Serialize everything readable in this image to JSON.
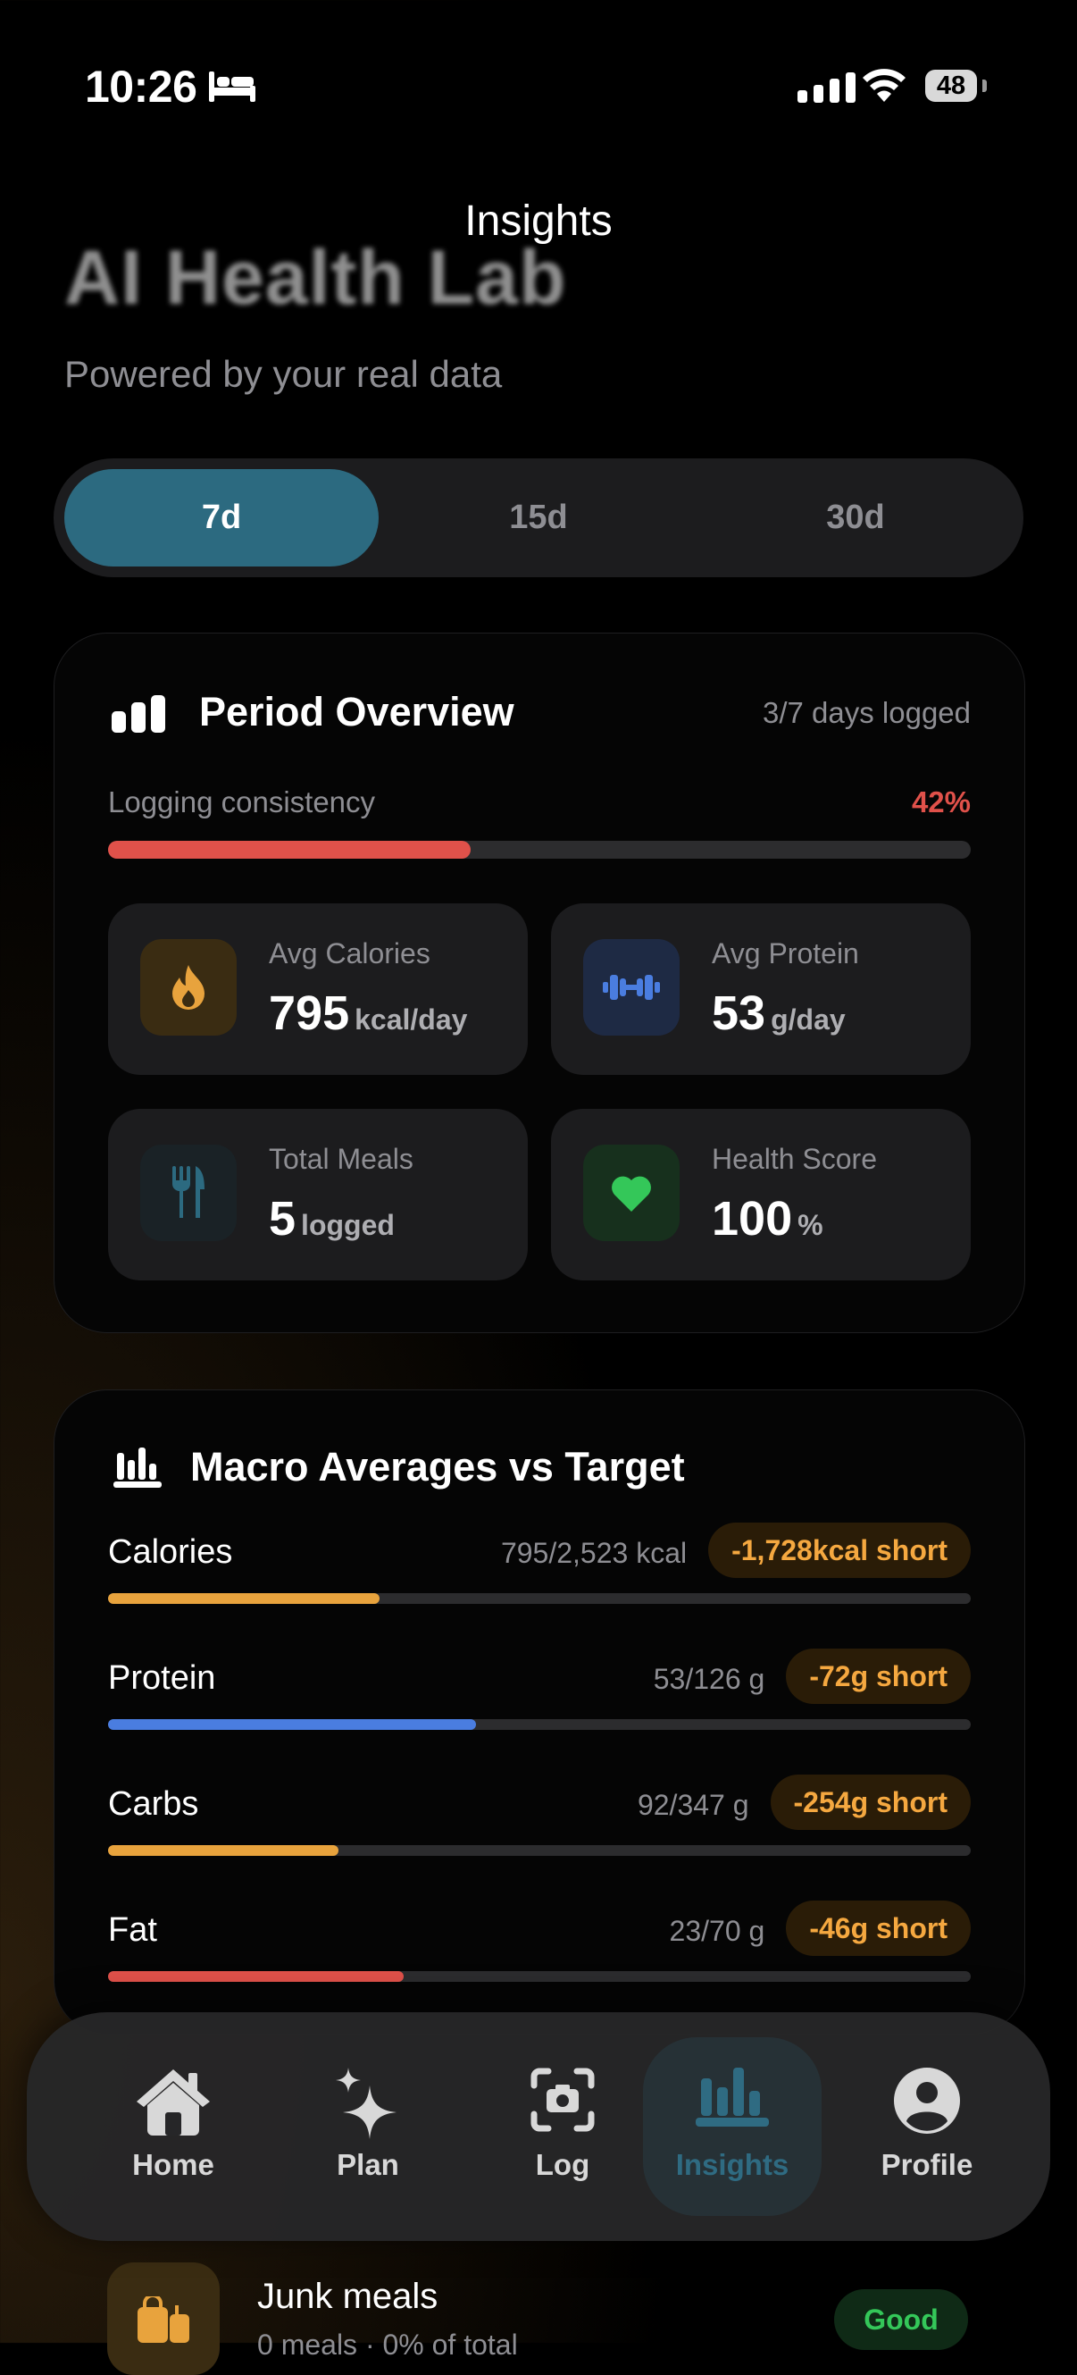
{
  "status_bar": {
    "time": "10:26",
    "battery": "48"
  },
  "header": {
    "nav_title": "Insights",
    "large_title": "AI Health Lab",
    "subtitle": "Powered by your real data"
  },
  "period_selector": {
    "options": [
      "7d",
      "15d",
      "30d"
    ],
    "selected": "7d"
  },
  "period_overview": {
    "title": "Period Overview",
    "days_logged": "3/7 days logged",
    "consistency_label": "Logging consistency",
    "consistency_value": "42%",
    "consistency_fraction": 0.42,
    "stats": [
      {
        "label": "Avg Calories",
        "value": "795",
        "unit": "kcal/day",
        "icon": "flame-icon"
      },
      {
        "label": "Avg Protein",
        "value": "53",
        "unit": "g/day",
        "icon": "dumbbell-icon"
      },
      {
        "label": "Total Meals",
        "value": "5",
        "unit": "logged",
        "icon": "fork-knife-icon"
      },
      {
        "label": "Health Score",
        "value": "100",
        "unit": "%",
        "icon": "heart-icon"
      }
    ]
  },
  "macro_averages": {
    "title": "Macro Averages vs Target",
    "items": [
      {
        "name": "Calories",
        "value": "795/2,523 kcal",
        "status": "-1,728kcal short",
        "fraction": 0.315,
        "color": "#e8a33d"
      },
      {
        "name": "Protein",
        "value": "53/126 g",
        "status": "-72g short",
        "fraction": 0.426,
        "color": "#4a7de0"
      },
      {
        "name": "Carbs",
        "value": "92/347 g",
        "status": "-254g short",
        "fraction": 0.267,
        "color": "#e8a33d"
      },
      {
        "name": "Fat",
        "value": "23/70 g",
        "status": "-46g short",
        "fraction": 0.343,
        "color": "#e0514a"
      }
    ]
  },
  "tab_bar": {
    "tabs": [
      {
        "label": "Home",
        "icon": "house-icon"
      },
      {
        "label": "Plan",
        "icon": "sparkles-icon"
      },
      {
        "label": "Log",
        "icon": "camera-scan-icon"
      },
      {
        "label": "Insights",
        "icon": "chart-bars-icon"
      },
      {
        "label": "Profile",
        "icon": "person-circle-icon"
      }
    ],
    "selected": "Insights"
  },
  "junk_meals": {
    "title": "Junk meals",
    "subtitle": "0 meals · 0% of total",
    "badge": "Good"
  }
}
